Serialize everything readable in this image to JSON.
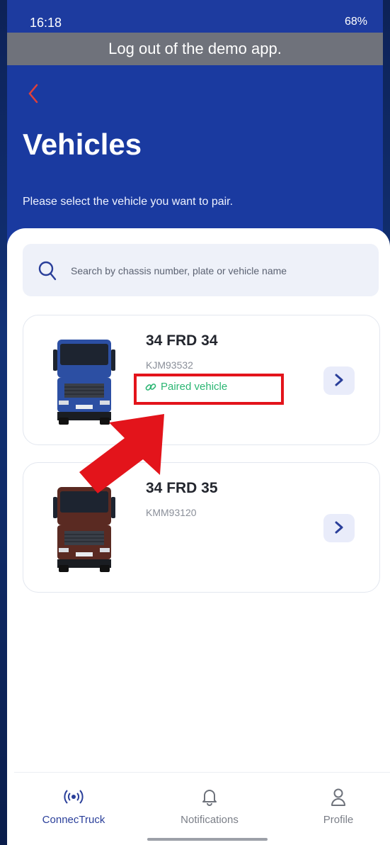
{
  "status_bar": {
    "time": "16:18",
    "indicators": "68%"
  },
  "banner": {
    "text": "Log out of the demo app."
  },
  "header": {
    "back_icon": "chevron-left-icon",
    "title": "Vehicles",
    "subtitle": "Please select the vehicle you want to pair."
  },
  "search": {
    "placeholder": "Search by chassis number, plate or vehicle name",
    "icon": "search-icon"
  },
  "vehicles": [
    {
      "plate": "34 FRD 34",
      "chassis": "KJM93532",
      "status": "Paired vehicle",
      "color": "#2c4fa3"
    },
    {
      "plate": "34 FRD 35",
      "chassis": "KMM93120",
      "color": "#5a2a22"
    }
  ],
  "bottom_nav": {
    "items": [
      {
        "label": "ConnecTruck",
        "icon": "broadcast-icon",
        "active": true
      },
      {
        "label": "Notifications",
        "icon": "bell-icon",
        "active": false
      },
      {
        "label": "Profile",
        "icon": "user-icon",
        "active": false
      }
    ]
  },
  "colors": {
    "header_blue": "#1a3aa0",
    "paired_green": "#2bb673",
    "annotation_red": "#e3141b",
    "active_nav": "#2a3f9a"
  }
}
